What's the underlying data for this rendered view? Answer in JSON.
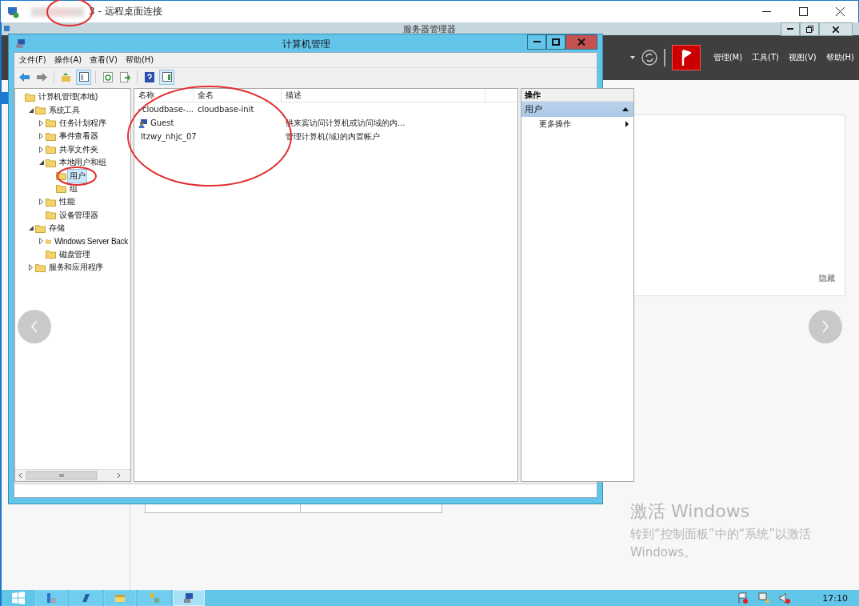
{
  "rdp_window": {
    "title": "3 - 远程桌面连接"
  },
  "server_manager": {
    "title": "服务器管理器",
    "menu": [
      "管理(M)",
      "工具(T)",
      "视图(V)",
      "帮助(H)"
    ],
    "tile": {
      "hide_link": "隐藏"
    }
  },
  "computer_management": {
    "title": "计算机管理",
    "menu": [
      "文件(F)",
      "操作(A)",
      "查看(V)",
      "帮助(H)"
    ],
    "tree": [
      {
        "label": "计算机管理(本地)",
        "selected": false,
        "children": [
          {
            "label": "系统工具",
            "selected": false,
            "expanded": true,
            "children": [
              {
                "label": "任务计划程序",
                "selected": false,
                "expanded": false
              },
              {
                "label": "事件查看器",
                "selected": false,
                "expanded": false
              },
              {
                "label": "共享文件夹",
                "selected": false,
                "expanded": false
              },
              {
                "label": "本地用户和组",
                "selected": false,
                "expanded": true,
                "children": [
                  {
                    "label": "用户",
                    "selected": true
                  },
                  {
                    "label": "组",
                    "selected": false
                  }
                ]
              },
              {
                "label": "性能",
                "selected": false,
                "expanded": false
              },
              {
                "label": "设备管理器",
                "selected": false
              }
            ]
          },
          {
            "label": "存储",
            "selected": false,
            "expanded": true,
            "children": [
              {
                "label": "Windows Server Back",
                "selected": false,
                "expanded": false
              },
              {
                "label": "磁盘管理",
                "selected": false
              }
            ]
          },
          {
            "label": "服务和应用程序",
            "selected": false,
            "expanded": false
          }
        ]
      }
    ],
    "list": {
      "columns": [
        "名称",
        "全名",
        "描述"
      ],
      "rows": [
        {
          "name": "cloudbase-...",
          "full_name": "cloudbase-init"
        },
        {
          "name": "Guest",
          "description": "供来宾访问计算机或访问域的内..."
        },
        {
          "name": "ltzwy_nhjc_07",
          "description": "管理计算机(域)的内置帐户"
        }
      ]
    },
    "actions": {
      "header": "操作",
      "section": {
        "title": "用户",
        "expanded": true
      },
      "items": [
        "更多操作"
      ]
    }
  },
  "activation": {
    "title": "激活 Windows",
    "lines": [
      "转到“控制面板”中的“系统”以激活",
      "Windows。"
    ]
  },
  "taskbar": {
    "apps": [
      {
        "selected": false
      },
      {
        "selected": false
      },
      {
        "selected": false
      },
      {
        "selected": false
      },
      {
        "selected": true
      }
    ],
    "clock": "17:10"
  }
}
